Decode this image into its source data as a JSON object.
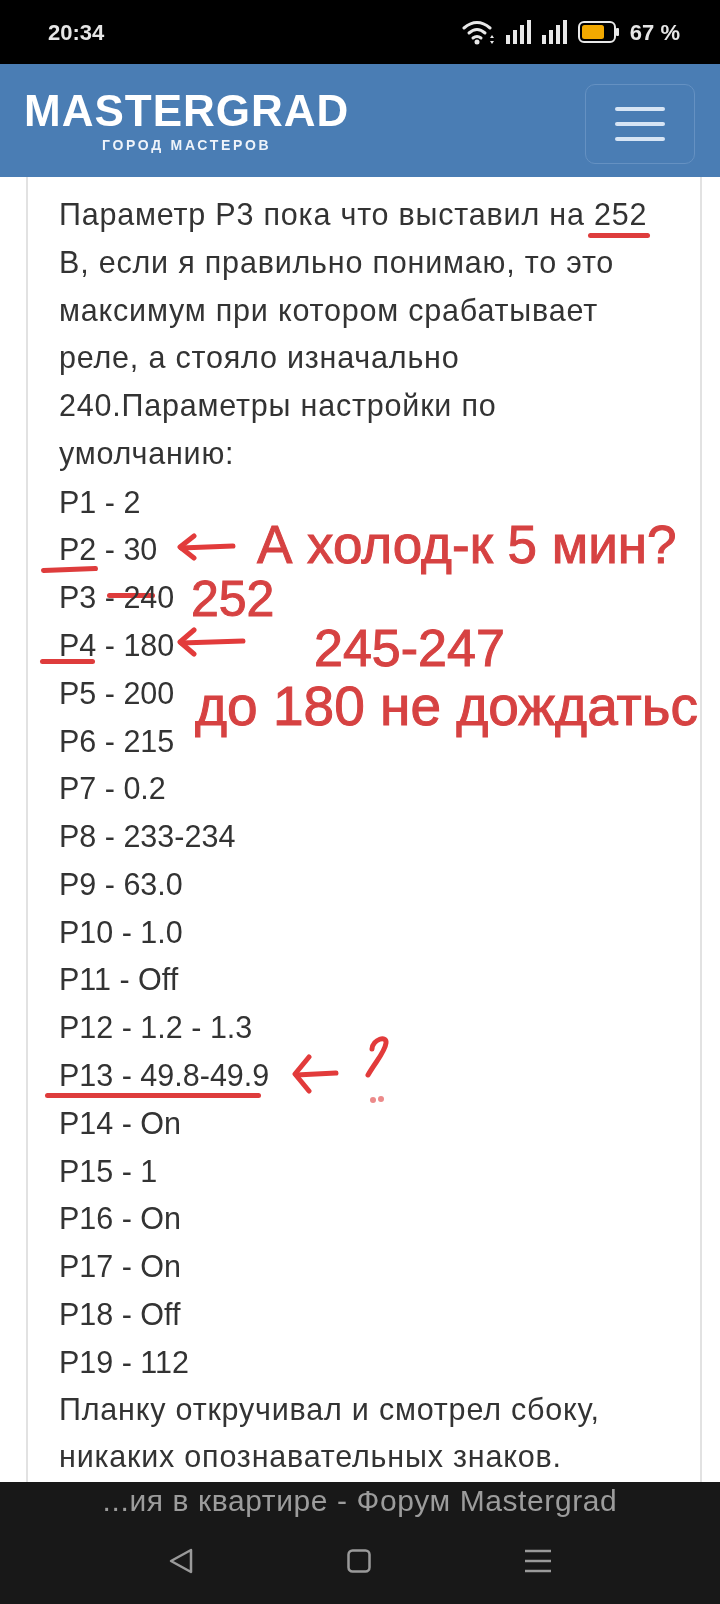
{
  "status_bar": {
    "time": "20:34",
    "battery": "67 %"
  },
  "header": {
    "logo": "MASTERGRAD",
    "tagline": "ГОРОД МАСТЕРОВ"
  },
  "post": {
    "intro_lines": [
      "Параметр P3 пока что выставил на 252",
      "В, если я правильно понимаю, то это",
      "максимум при котором срабатывает",
      "реле, а стояло изначально",
      "240.Параметры настройки по",
      "умолчанию:"
    ],
    "params": [
      "P1 - 2",
      "P2 - 30",
      "P3 - 240",
      "P4 - 180",
      "P5 - 200",
      "P6 - 215",
      "P7 - 0.2",
      "P8 - 233-234",
      "P9 - 63.0",
      "P10 - 1.0",
      "P11 - Off",
      "P12 - 1.2 - 1.3",
      "P13 - 49.8-49.9",
      "P14 - On",
      "P15 - 1",
      "P16 - On",
      "P17 - On",
      "P18 - Off",
      "P19 - 112"
    ],
    "outro_lines": [
      "Планку откручивал и смотрел сбоку,",
      "никаких опознавательных знаков."
    ]
  },
  "notes": [
    "А холод-к 5 мин?",
    "252",
    "245-247",
    "до 180 не дождатьс"
  ],
  "bottom_bar": {
    "page_title": "...ия в квартире - Форум Mastergrad"
  }
}
